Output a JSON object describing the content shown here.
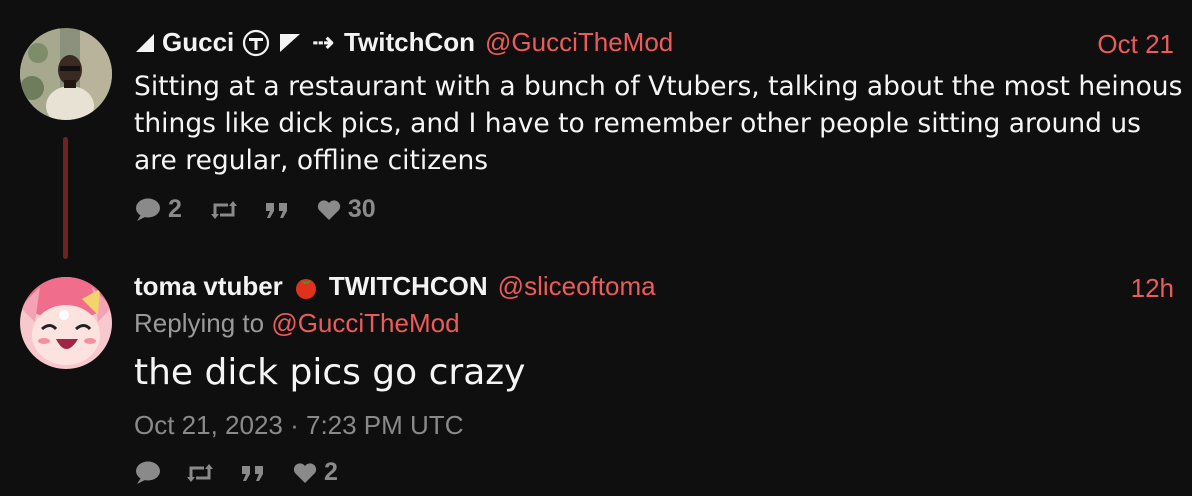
{
  "tweets": [
    {
      "display_name": "Gucci",
      "arrow": "⇢",
      "affiliation": "TwitchCon",
      "handle": "@GucciTheMod",
      "time": "Oct 21",
      "text": "Sitting at a restaurant with a bunch of Vtubers, talking about the most heinous things like dick pics, and I have to remember other people sitting around us are regular, offline citizens",
      "stats": {
        "replies": "2",
        "likes": "30"
      }
    },
    {
      "display_name_part1": "toma vtuber",
      "display_name_part2": "TWITCHCON",
      "handle": "@sliceoftoma",
      "time": "12h",
      "replying_prefix": "Replying to",
      "replying_to": "@GucciTheMod",
      "text": "the dick pics go crazy",
      "full_date": "Oct 21, 2023 · 7:23 PM UTC",
      "stats": {
        "likes": "2"
      }
    }
  ],
  "colors": {
    "background": "#0f0f0f",
    "accent": "#ec5b5b",
    "muted": "#8a8a8a",
    "thread_line": "#6e2323"
  },
  "icons": [
    "signal-triangle-icon",
    "circle-emblem-icon",
    "flag-triangle-icon",
    "tomato-emoji-icon",
    "reply-icon",
    "retweet-icon",
    "quote-icon",
    "heart-icon"
  ]
}
